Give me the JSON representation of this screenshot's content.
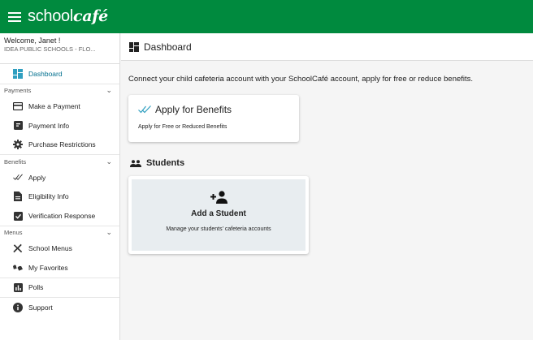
{
  "brand": {
    "name": "school",
    "name_em": "café"
  },
  "sidebar": {
    "welcome": "Welcome, Janet !",
    "school": "IDEA PUBLIC SCHOOLS - FLO...",
    "dashboard": "Dashboard",
    "payments_section": "Payments",
    "make_payment": "Make a Payment",
    "payment_info": "Payment Info",
    "purchase_restrictions": "Purchase Restrictions",
    "benefits_section": "Benefits",
    "apply": "Apply",
    "eligibility_info": "Eligibility Info",
    "verification_response": "Verification Response",
    "menus_section": "Menus",
    "school_menus": "School Menus",
    "my_favorites": "My Favorites",
    "polls": "Polls",
    "support": "Support"
  },
  "main": {
    "page_title": "Dashboard",
    "intro": "Connect your child cafeteria account with your SchoolCafé account, apply for free or reduce benefits.",
    "benefits_card": {
      "title": "Apply for Benefits",
      "subtitle": "Apply for Free or Reduced Benefits"
    },
    "students_heading": "Students",
    "student_card": {
      "title": "Add a Student",
      "subtitle": "Manage your students' cafeteria accounts"
    }
  },
  "colors": {
    "topbar": "#008a3e",
    "accent": "#006f8e",
    "card_bg": "#e8edf0"
  },
  "icons": [
    "menu-icon",
    "dashboard-icon",
    "credit-card-icon",
    "payment-info-icon",
    "restriction-gear-icon",
    "double-check-icon",
    "document-icon",
    "clipboard-check-icon",
    "utensils-icon",
    "favorites-icon",
    "polls-icon",
    "info-icon",
    "students-icon",
    "add-person-icon",
    "chevron-down-icon"
  ]
}
